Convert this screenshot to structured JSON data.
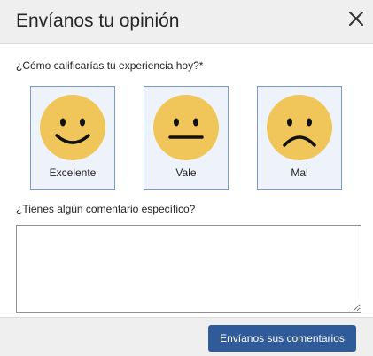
{
  "dialog": {
    "title": "Envíanos tu opinión",
    "close_icon": "close-icon"
  },
  "rating": {
    "question": "¿Cómo calificarías tu experiencia hoy?*",
    "options": [
      {
        "label": "Excelente",
        "icon": "happy-face-icon"
      },
      {
        "label": "Vale",
        "icon": "neutral-face-icon"
      },
      {
        "label": "Mal",
        "icon": "sad-face-icon"
      }
    ]
  },
  "comment": {
    "question": "¿Tienes algún comentario específico?",
    "value": ""
  },
  "footer": {
    "submit_label": "Envíanos sus comentarios"
  },
  "colors": {
    "face": "#f0c55a",
    "option_background": "#eef2fa",
    "option_border": "#7d97cf",
    "primary_button": "#2f5b9b",
    "header_background": "#efefef"
  }
}
